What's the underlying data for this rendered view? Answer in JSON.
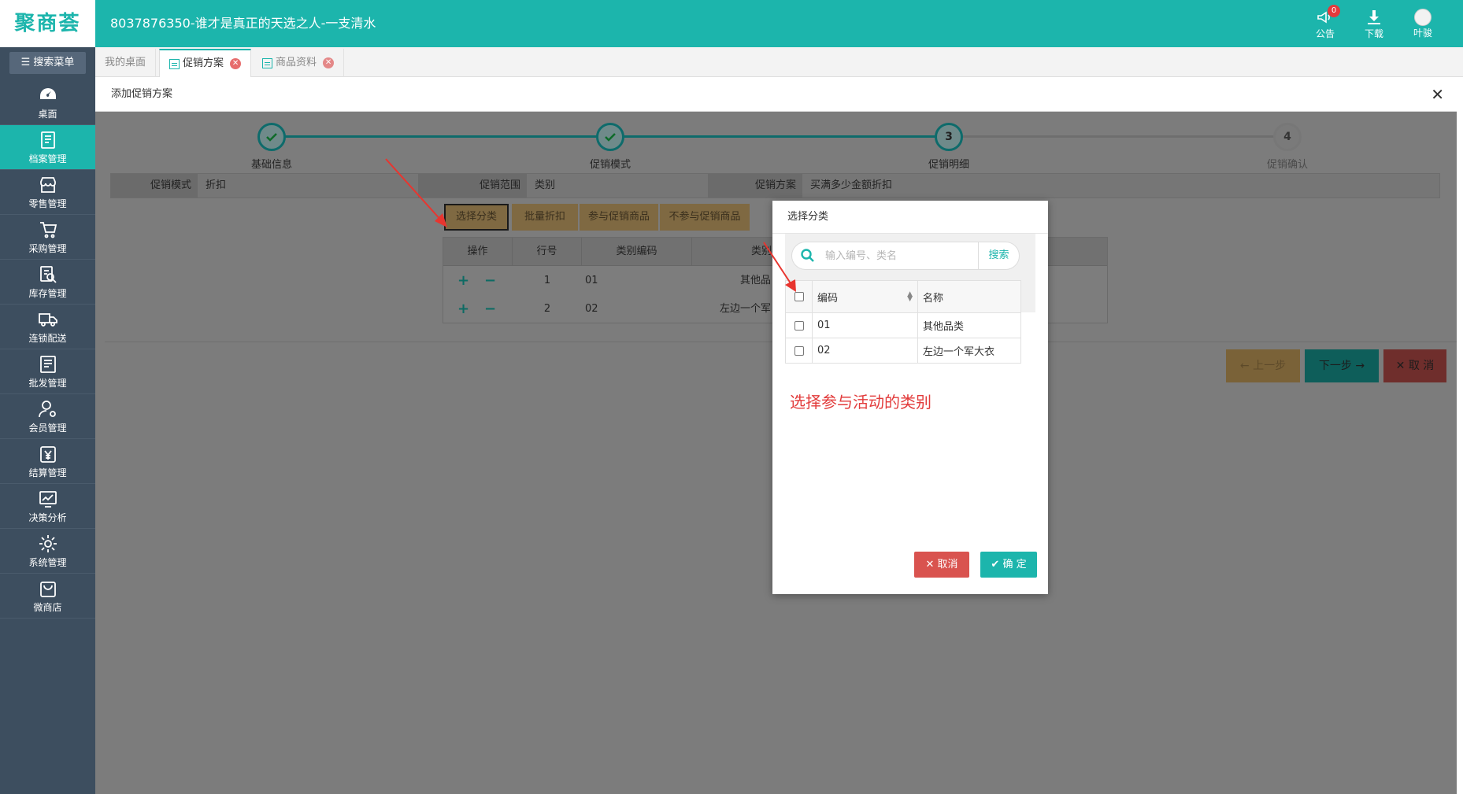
{
  "app": {
    "logo_text": "聚商荟",
    "store_title": "8037876350-谁才是真正的天选之人-一支清水",
    "top_actions": {
      "notice_label": "公告",
      "notice_count": "0",
      "download_label": "下载",
      "user_label": "叶骏"
    }
  },
  "sidebar": {
    "search_label": "搜索菜单",
    "items": [
      {
        "label": "桌面",
        "icon": "dashboard-icon"
      },
      {
        "label": "档案管理",
        "icon": "archive-icon"
      },
      {
        "label": "零售管理",
        "icon": "store-icon"
      },
      {
        "label": "采购管理",
        "icon": "cart-icon"
      },
      {
        "label": "库存管理",
        "icon": "inventory-icon"
      },
      {
        "label": "连锁配送",
        "icon": "truck-icon"
      },
      {
        "label": "批发管理",
        "icon": "wholesale-icon"
      },
      {
        "label": "会员管理",
        "icon": "member-icon"
      },
      {
        "label": "结算管理",
        "icon": "yen-icon"
      },
      {
        "label": "决策分析",
        "icon": "chart-icon"
      },
      {
        "label": "系统管理",
        "icon": "gear-icon"
      },
      {
        "label": "微商店",
        "icon": "bag-icon"
      }
    ],
    "active_index": 1
  },
  "tabs": [
    {
      "label": "我的桌面"
    },
    {
      "label": "促销方案"
    },
    {
      "label": "商品资料"
    }
  ],
  "panel": {
    "title": "添加促销方案",
    "close_glyph": "✕"
  },
  "stepper": {
    "steps": [
      {
        "label": "基础信息",
        "status": "done",
        "number": ""
      },
      {
        "label": "促销模式",
        "status": "done",
        "number": ""
      },
      {
        "label": "促销明细",
        "status": "current",
        "number": "3"
      },
      {
        "label": "促销确认",
        "status": "todo",
        "number": "4"
      }
    ]
  },
  "info": {
    "mode_key": "促销模式",
    "mode_value": "折扣",
    "scope_key": "促销范围",
    "scope_value": "类别",
    "plan_key": "促销方案",
    "plan_value": "买满多少金额折扣"
  },
  "actions": {
    "select_category": "选择分类",
    "batch_discount": "批量折扣",
    "include_goods": "参与促销商品",
    "exclude_goods": "不参与促销商品"
  },
  "detail_table": {
    "headers": [
      "操作",
      "行号",
      "类别编码",
      "类别名"
    ],
    "rows": [
      {
        "line": "1",
        "code": "01",
        "name": "其他品"
      },
      {
        "line": "2",
        "code": "02",
        "name": "左边一个军"
      }
    ]
  },
  "nav_buttons": {
    "prev": "上一步",
    "next": "下一步",
    "cancel": "取 消"
  },
  "dialog": {
    "title": "选择分类",
    "search_placeholder": "输入编号、类名",
    "search_button": "搜索",
    "col_code": "编码",
    "col_name": "名称",
    "rows": [
      {
        "code": "01",
        "name": "其他品类"
      },
      {
        "code": "02",
        "name": "左边一个军大衣"
      }
    ],
    "annotation": "选择参与活动的类别",
    "cancel": "取消",
    "confirm": "确 定"
  },
  "colors": {
    "brand": "#1cb5ac",
    "sidebar": "#3d4e5f",
    "danger": "#d9534f",
    "warning": "#f0ad4e",
    "annotation": "#e23b3b"
  }
}
